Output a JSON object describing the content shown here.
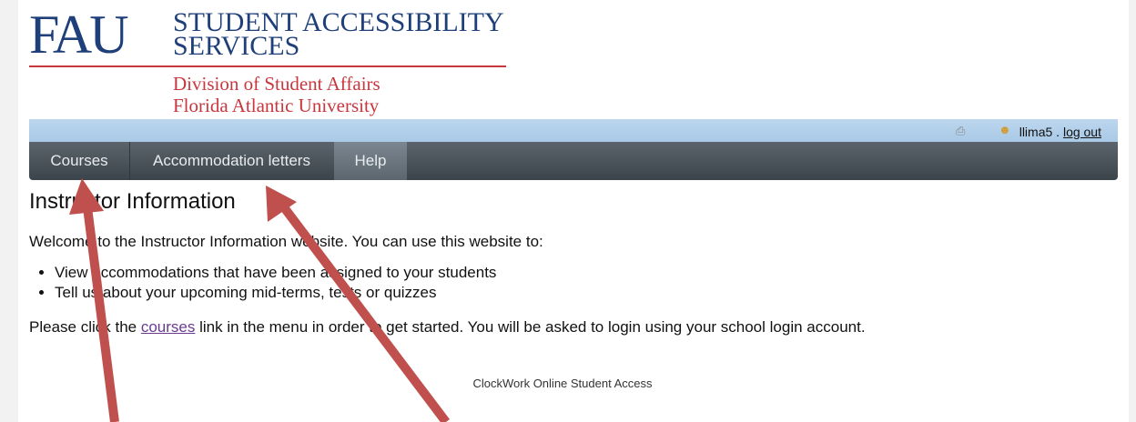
{
  "header": {
    "logo_mark": "FAU",
    "title": "STUDENT ACCESSIBILITY SERVICES",
    "subtitle_line1": "Division of Student Affairs",
    "subtitle_line2": "Florida Atlantic University",
    "brand_blue": "#1e3f79",
    "brand_red": "#c8373e"
  },
  "userbar": {
    "printer_icon": "printer-icon",
    "user_icon": "user-icon",
    "username": "llima5",
    "separator": " . ",
    "logout_label": "log out"
  },
  "nav": {
    "items": [
      {
        "label": "Courses"
      },
      {
        "label": "Accommodation letters"
      },
      {
        "label": "Help"
      }
    ]
  },
  "main": {
    "title": "Instructor Information",
    "intro": "Welcome to the Instructor Information website. You can use this website to:",
    "features": [
      "View accommodations that have been assigned to your students",
      "Tell us about your upcoming mid-terms, tests or quizzes"
    ],
    "cta_before": "Please click the ",
    "cta_link": "courses",
    "cta_after": " link in the menu in order to get started. You will be asked to login using your school login account."
  },
  "footer": {
    "text": "ClockWork Online Student Access"
  },
  "annotation": {
    "arrow_color": "#c0504d"
  }
}
